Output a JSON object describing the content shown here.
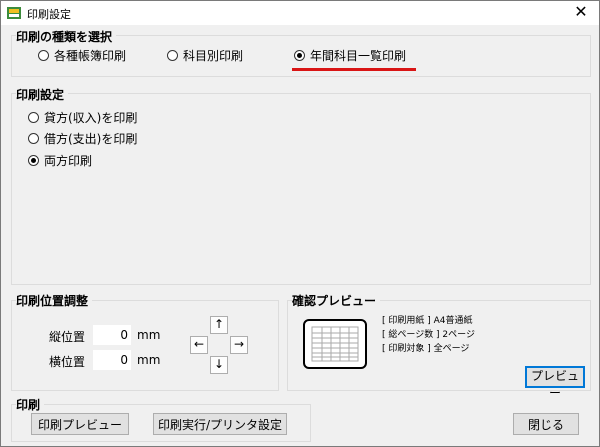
{
  "window": {
    "title": "印刷設定",
    "close": "✕"
  },
  "type_group": {
    "title": "印刷の種類を選択",
    "options": [
      {
        "label": "各種帳簿印刷",
        "checked": false
      },
      {
        "label": "科目別印刷",
        "checked": false
      },
      {
        "label": "年間科目一覧印刷",
        "checked": true
      }
    ],
    "highlight_color": "#d91515"
  },
  "settings_group": {
    "title": "印刷設定",
    "options": [
      {
        "label": "貸方(収入)を印刷",
        "checked": false
      },
      {
        "label": "借方(支出)を印刷",
        "checked": false
      },
      {
        "label": "両方印刷",
        "checked": true
      }
    ]
  },
  "position_group": {
    "title": "印刷位置調整",
    "vertical_label": "縦位置",
    "vertical_value": "0",
    "horizontal_label": "横位置",
    "horizontal_value": "0",
    "unit": "mm",
    "arrows": {
      "up": "↑",
      "left": "←",
      "right": "→",
      "down": "↓"
    }
  },
  "preview_group": {
    "title": "確認プレビュー",
    "lines": [
      "[ 印刷用紙 ] A4普通紙",
      "[ 総ページ数 ] 2ページ",
      "[ 印刷対象 ] 全ページ"
    ],
    "preview_button": "プレビュー"
  },
  "print_group": {
    "title": "印刷",
    "preview_button": "印刷プレビュー",
    "execute_button": "印刷実行/プリンタ設定"
  },
  "close_button": "閉じる"
}
